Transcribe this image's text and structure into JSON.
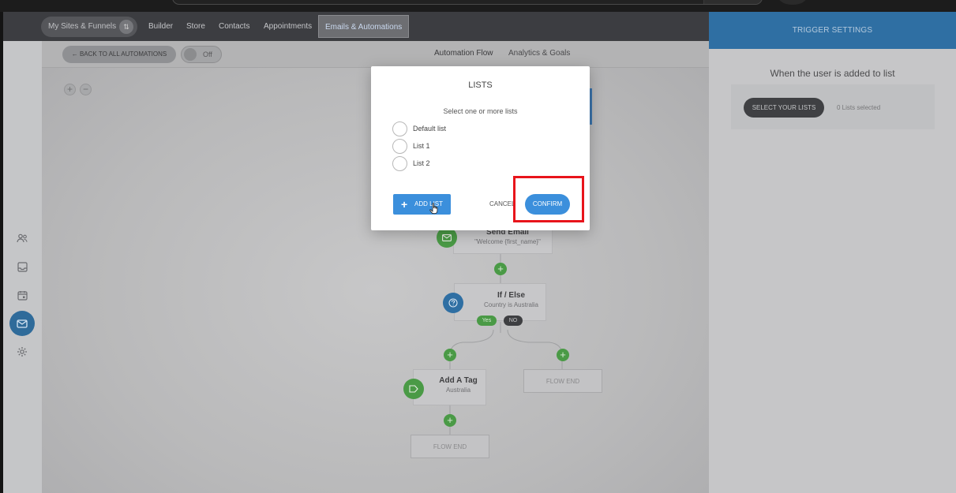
{
  "navbar": {
    "items": [
      {
        "label": "My Sites & Funnels",
        "badge": "⇅"
      },
      {
        "label": "Builder"
      },
      {
        "label": "Store"
      },
      {
        "label": "Contacts"
      },
      {
        "label": "Appointments"
      },
      {
        "label": "Emails & Automations",
        "active": true
      }
    ]
  },
  "subheader": {
    "back_label": "← BACK TO ALL AUTOMATIONS",
    "toggle_label": "Off",
    "tabs": [
      {
        "label": "Automation Flow",
        "active": true
      },
      {
        "label": "Analytics & Goals"
      }
    ]
  },
  "zoom": {
    "in": "+",
    "out": "−"
  },
  "flow": {
    "send_email": {
      "title": "Send Email",
      "subtitle": "\"Welcome {first_name}\""
    },
    "if_else": {
      "title": "If / Else",
      "subtitle": "Country is Australia",
      "yes": "Yes",
      "no": "NO"
    },
    "add_tag": {
      "title": "Add A Tag",
      "subtitle": "Australia"
    },
    "flow_end_right": "FLOW END",
    "flow_end_bottom": "FLOW END"
  },
  "right_panel": {
    "header": "TRIGGER SETTINGS",
    "trigger_text": "When the user is added to list",
    "select_button": "SELECT YOUR LISTS",
    "selected_count": "0 Lists selected"
  },
  "modal": {
    "title": "LISTS",
    "hint": "Select one or more lists",
    "options": [
      "Default list",
      "List 1",
      "List 2"
    ],
    "add_list": "ADD LIST",
    "cancel": "CANCEL",
    "confirm": "CONFIRM"
  },
  "colors": {
    "accent": "#3b8fdc",
    "nav_bg": "#3c3d41",
    "panel_header": "#2f6fa3",
    "node_green": "#4a9a46",
    "node_blue": "#2f6fa3",
    "highlight": "#e8141b"
  }
}
